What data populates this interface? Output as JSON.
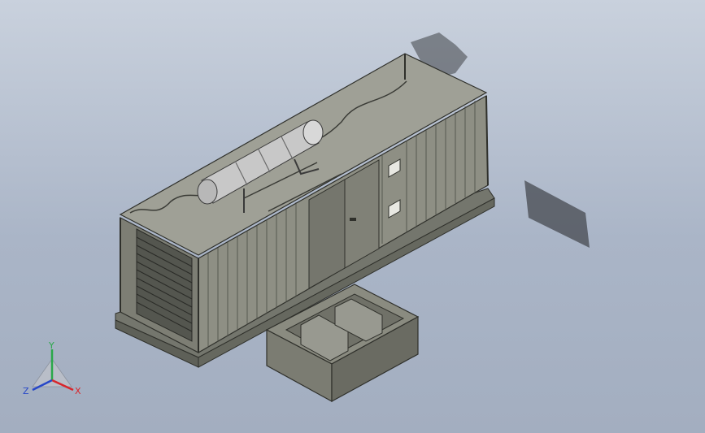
{
  "triad": {
    "labels": {
      "x": "X",
      "y": "Y",
      "z": "Z"
    },
    "colors": {
      "x": "#d8262c",
      "y": "#2aa84a",
      "z": "#2747c8"
    }
  },
  "scene": {
    "objects": [
      "generator-container",
      "exhaust-silencer",
      "base-frame",
      "fuel-tank-box"
    ],
    "colors": {
      "body": "#8e8f84",
      "top": "#9fa096",
      "shadow": "#5e6058",
      "edge": "#2f302b",
      "muffler": "#c8c8c8"
    }
  }
}
